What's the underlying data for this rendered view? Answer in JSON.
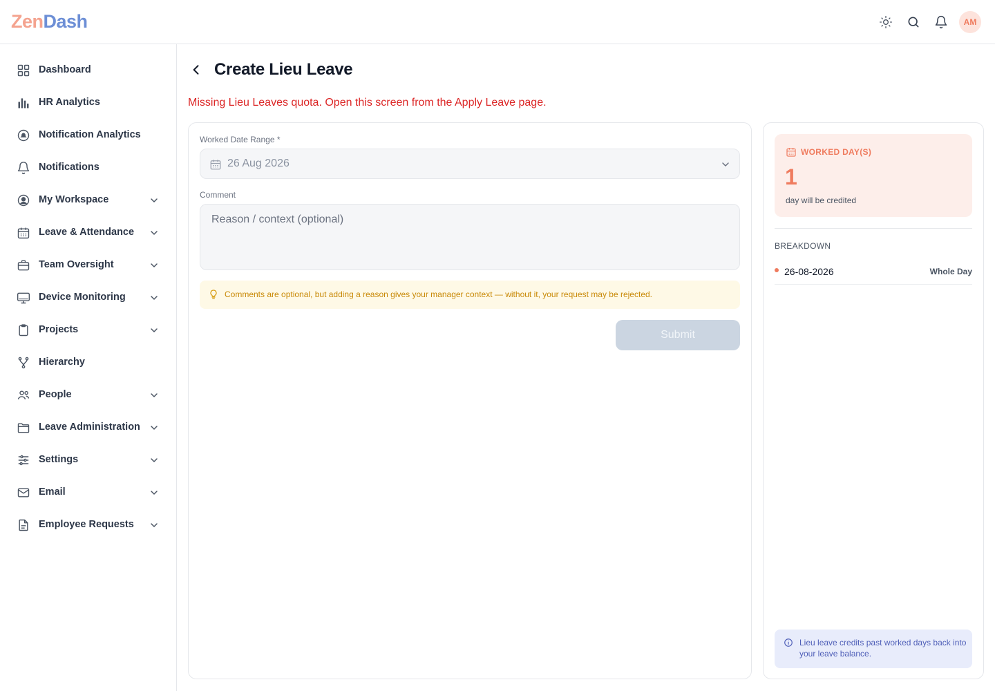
{
  "app": {
    "logo_part1": "Zen",
    "logo_part2": "Dash",
    "user_initials": "AM"
  },
  "sidebar": {
    "items": [
      {
        "label": "Dashboard",
        "icon": "grid-icon",
        "expandable": false
      },
      {
        "label": "HR Analytics",
        "icon": "bar-chart-icon",
        "expandable": false
      },
      {
        "label": "Notification Analytics",
        "icon": "bell-circle-icon",
        "expandable": false
      },
      {
        "label": "Notifications",
        "icon": "bell-icon",
        "expandable": false
      },
      {
        "label": "My Workspace",
        "icon": "user-circle-icon",
        "expandable": true
      },
      {
        "label": "Leave & Attendance",
        "icon": "calendar-icon",
        "expandable": true
      },
      {
        "label": "Team Oversight",
        "icon": "briefcase-icon",
        "expandable": true
      },
      {
        "label": "Device Monitoring",
        "icon": "monitor-icon",
        "expandable": true
      },
      {
        "label": "Projects",
        "icon": "clipboard-icon",
        "expandable": true
      },
      {
        "label": "Hierarchy",
        "icon": "branch-icon",
        "expandable": false
      },
      {
        "label": "People",
        "icon": "users-icon",
        "expandable": true
      },
      {
        "label": "Leave Administration",
        "icon": "folder-icon",
        "expandable": true
      },
      {
        "label": "Settings",
        "icon": "sliders-icon",
        "expandable": true
      },
      {
        "label": "Email",
        "icon": "mail-icon",
        "expandable": true
      },
      {
        "label": "Employee Requests",
        "icon": "document-icon",
        "expandable": true
      }
    ]
  },
  "page": {
    "title": "Create Lieu Leave",
    "error": "Missing Lieu Leaves quota. Open this screen from the Apply Leave page."
  },
  "form": {
    "date_label": "Worked Date Range *",
    "date_value": "26 Aug 2026",
    "comment_label": "Comment",
    "comment_placeholder": "Reason / context (optional)",
    "hint": "Comments are optional, but adding a reason gives your manager context — without it, your request may be rejected.",
    "submit_label": "Submit"
  },
  "summary": {
    "worked_label": "WORKED DAY(S)",
    "worked_count": "1",
    "worked_sub": "day will be credited",
    "breakdown_title": "BREAKDOWN",
    "breakdown": [
      {
        "date": "26-08-2026",
        "type": "Whole Day"
      }
    ],
    "info": "Lieu leave credits past worked days back into your leave balance."
  },
  "colors": {
    "accent": "#ef7b5e",
    "error": "#dc2626",
    "hint_text": "#c98a08",
    "info_text": "#4f5fb8",
    "disabled_button": "#cbd5e1"
  }
}
